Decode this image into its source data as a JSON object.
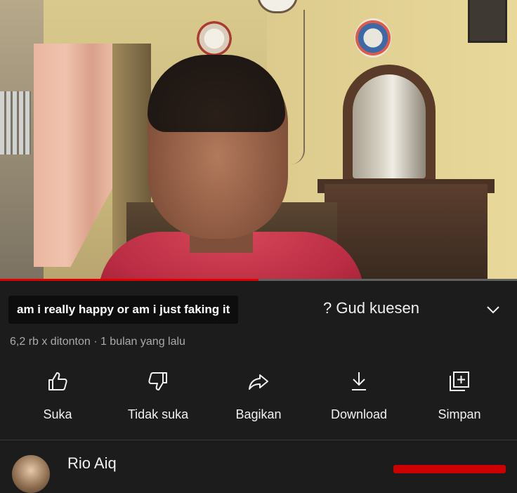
{
  "video": {
    "progress_fraction": 0.5
  },
  "title": {
    "highlight_text": "am i really happy or am i just faking it",
    "rest_text": "? Gud kuesen",
    "expand_icon": "chevron-down-icon"
  },
  "meta": {
    "text": "6,2 rb x ditonton · 1 bulan yang lalu"
  },
  "actions": [
    {
      "label": "Suka",
      "icon": "thumbs-up-icon"
    },
    {
      "label": "Tidak suka",
      "icon": "thumbs-down-icon"
    },
    {
      "label": "Bagikan",
      "icon": "share-icon"
    },
    {
      "label": "Download",
      "icon": "download-icon"
    },
    {
      "label": "Simpan",
      "icon": "add-to-playlist-icon"
    }
  ],
  "channel": {
    "name": "Rio Aiq"
  },
  "colors": {
    "background": "#1c1c1c",
    "progress": "#e00000",
    "text_primary": "#f1f1f1",
    "text_secondary": "#aaaaaa"
  }
}
